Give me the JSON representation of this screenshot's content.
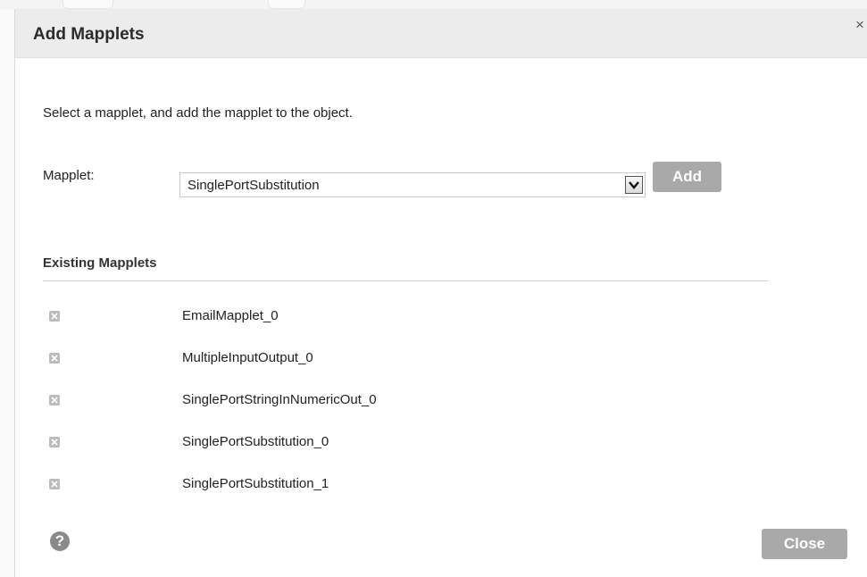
{
  "dialog": {
    "title": "Add Mapplets",
    "close_glyph": "×",
    "instruction": "Select a mapplet, and add the mapplet to the object.",
    "mapplet_label": "Mapplet:",
    "mapplet_selected": "SinglePortSubstitution",
    "add_label": "Add",
    "existing_heading": "Existing Mapplets",
    "existing": [
      {
        "name": "EmailMapplet_0"
      },
      {
        "name": "MultipleInputOutput_0"
      },
      {
        "name": "SinglePortStringInNumericOut_0"
      },
      {
        "name": "SinglePortSubstitution_0"
      },
      {
        "name": "SinglePortSubstitution_1"
      }
    ],
    "help_glyph": "?",
    "close_label": "Close"
  },
  "icons": {
    "remove": "remove-icon",
    "dropdown": "chevron-down-icon",
    "help": "help-icon",
    "close": "close-icon"
  },
  "colors": {
    "header_bg": "#ececec",
    "button_bg": "#a9a9a9",
    "remove_icon": "#bcbcbc",
    "help_icon": "#8a8a8a"
  }
}
